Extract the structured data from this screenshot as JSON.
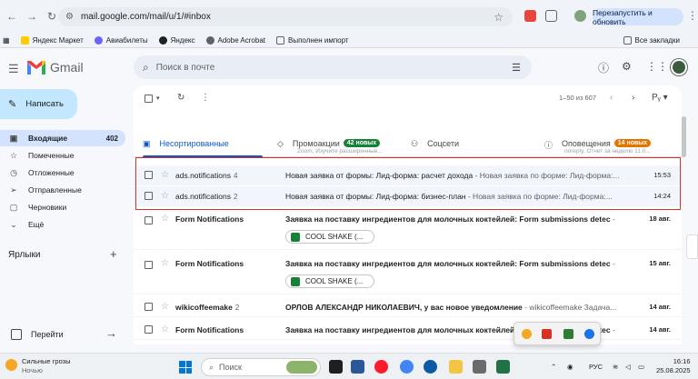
{
  "browser": {
    "url": "mail.google.com/mail/u/1/#inbox",
    "update_button": "Перезапустить и обновить",
    "bookmarks": [
      "Яндекс Маркет",
      "Авиабилеты",
      "Яндекс",
      "Adobe Acrobat",
      "Выполнен импорт"
    ],
    "all_bookmarks": "Все закладки"
  },
  "gmail": {
    "logo_text": "Gmail",
    "search_placeholder": "Поиск в почте",
    "compose_label": "Написать"
  },
  "sidebar": {
    "items": [
      {
        "label": "Входящие",
        "count": "402",
        "icon": "inbox-icon"
      },
      {
        "label": "Помеченные",
        "count": "",
        "icon": "star-icon"
      },
      {
        "label": "Отложенные",
        "count": "",
        "icon": "clock-icon"
      },
      {
        "label": "Отправленные",
        "count": "",
        "icon": "send-icon"
      },
      {
        "label": "Черновики",
        "count": "",
        "icon": "draft-icon"
      },
      {
        "label": "Ещё",
        "count": "",
        "icon": "chevron-down-icon"
      }
    ],
    "labels_title": "Ярлыки",
    "goto_label": "Перейти"
  },
  "toolbar": {
    "pager": "1–50 из 607"
  },
  "tabs": [
    {
      "label": "Несортированные",
      "badge": "",
      "sub": ""
    },
    {
      "label": "Промоакции",
      "badge": "42 новых",
      "sub": "Zoom, Изучите расширенные..."
    },
    {
      "label": "Соцсети",
      "badge": "",
      "sub": ""
    },
    {
      "label": "Оповещения",
      "badge": "14 новых",
      "sub": "noreply, Отчет за неделю 11.0..."
    }
  ],
  "emails": [
    {
      "from": "ads.notifications",
      "count": "4",
      "subject": "Новая заявка от формы: Лид-форма: расчет дохода",
      "snippet": " - Новая заявка по форме: Лид-форма:...",
      "date": "15:53",
      "unread": false,
      "chip": ""
    },
    {
      "from": "ads.notifications",
      "count": "2",
      "subject": "Новая заявка от формы: Лид-форма: бизнес-план",
      "snippet": " - Новая заявка по форме: Лид-форма:...",
      "date": "14:24",
      "unread": false,
      "chip": ""
    },
    {
      "from": "Form Notifications",
      "count": "",
      "subject": "Заявка на поставку ингредиентов для молочных коктейлей: Form submissions detec",
      "snippet": " -",
      "date": "18 авг.",
      "unread": true,
      "chip": "COOL SHAKE (..."
    },
    {
      "from": "Form Notifications",
      "count": "",
      "subject": "Заявка на поставку ингредиентов для молочных коктейлей: Form submissions detec",
      "snippet": " -",
      "date": "15 авг.",
      "unread": true,
      "chip": "COOL SHAKE (..."
    },
    {
      "from": "wikicoffeemake",
      "count": "2",
      "subject": "ОРЛОВ АЛЕКСАНДР НИКОЛАЕВИЧ, у вас новое уведомление",
      "snippet": " - wikicoffeemake Задача...",
      "date": "14 авг.",
      "unread": true,
      "chip": ""
    },
    {
      "from": "Form Notifications",
      "count": "",
      "subject": "Заявка на поставку ингредиентов для молочных коктейлей: Form submissions detec",
      "snippet": " -",
      "date": "14 авг.",
      "unread": true,
      "chip": ""
    }
  ],
  "taskbar": {
    "weather_title": "Сильные грозы",
    "weather_sub": "Ночью",
    "weather_badge": "3",
    "search_label": "Поиск",
    "lang": "РУС",
    "time": "16:16",
    "date": "25.08.2025"
  }
}
